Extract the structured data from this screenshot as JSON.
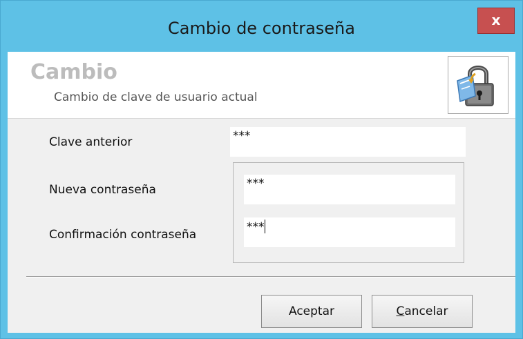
{
  "window": {
    "title": "Cambio de contraseña",
    "close_label": "x"
  },
  "header": {
    "title": "Cambio",
    "subtitle": "Cambio de clave de usuario actual",
    "icon": "padlock-key-icon"
  },
  "form": {
    "old_password": {
      "label": "Clave anterior",
      "value": "***"
    },
    "new_password": {
      "label": "Nueva contraseña",
      "value": "***"
    },
    "confirm_password": {
      "label": "Confirmación contraseña",
      "value": "***"
    }
  },
  "buttons": {
    "accept_label": "Aceptar",
    "cancel_mnemonic": "C",
    "cancel_rest": "ancelar"
  },
  "colors": {
    "titlebar": "#5ec1e6",
    "close": "#c75050",
    "client": "#f0f0f0",
    "header_title": "#bcbcbc"
  }
}
